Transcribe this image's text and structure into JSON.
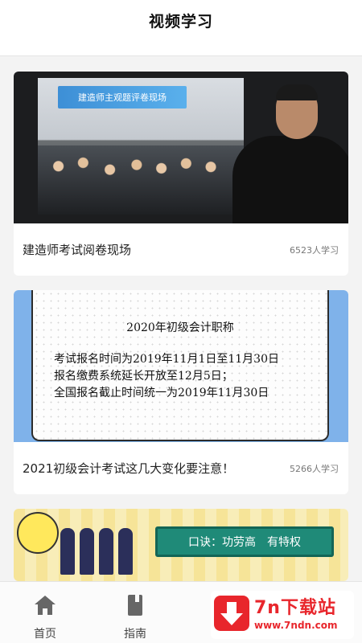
{
  "header": {
    "title": "视频学习"
  },
  "videos": [
    {
      "thumb_banner": "建造师主观题评卷现场",
      "title": "建造师考试阅卷现场",
      "count": "6523人学习"
    },
    {
      "notice_title": "2020年初级会计职称",
      "notice_lines": [
        "考试报名时间为2019年11月1日至11月30日",
        "报名缴费系统延长开放至12月5日；",
        "全国报名截止时间统一为2019年11月30日"
      ],
      "title": "2021初级会计考试这几大变化要注意！",
      "count": "5266人学习"
    },
    {
      "board_text": "口诀：功劳高　有特权"
    }
  ],
  "tabbar": {
    "items": [
      {
        "label": "首页",
        "icon": "home-icon"
      },
      {
        "label": "指南",
        "icon": "book-icon"
      }
    ]
  },
  "watermark": {
    "brand": "7n下载站",
    "url": "www.7ndn.com",
    "color": "#e8262c"
  }
}
